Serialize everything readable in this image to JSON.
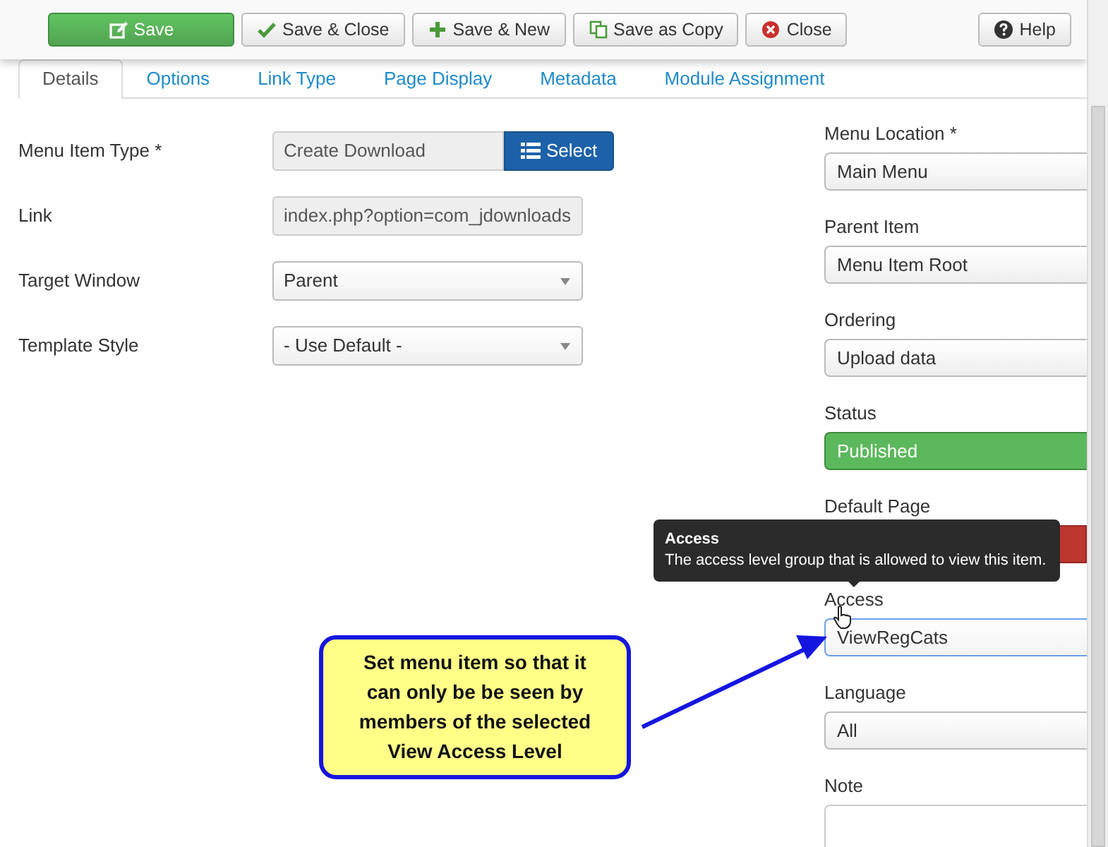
{
  "toolbar": {
    "buttons": [
      {
        "label": "Save",
        "kind": "save"
      },
      {
        "label": "Save & Close",
        "kind": "save-close"
      },
      {
        "label": "Save & New",
        "kind": "save-new"
      },
      {
        "label": "Save as Copy",
        "kind": "copy"
      },
      {
        "label": "Close",
        "kind": "close"
      }
    ],
    "help": {
      "label": "Help"
    }
  },
  "tabs": [
    {
      "label": "Details",
      "selected": true
    },
    {
      "label": "Options",
      "selected": false
    },
    {
      "label": "Link Type",
      "selected": false
    },
    {
      "label": "Page Display",
      "selected": false
    },
    {
      "label": "Metadata",
      "selected": false
    },
    {
      "label": "Module Assignment",
      "selected": false
    }
  ],
  "main_fields": [
    {
      "label": "Menu Item Type *",
      "kind": "type",
      "value": "Create Download",
      "button": "Select"
    },
    {
      "label": "Link",
      "kind": "readonly",
      "value": "index.php?option=com_jdownloads"
    },
    {
      "label": "Target Window",
      "kind": "select",
      "value": "Parent"
    },
    {
      "label": "Template Style",
      "kind": "select",
      "value": "- Use Default -"
    }
  ],
  "side_fields": [
    {
      "label": "Menu Location *",
      "kind": "select",
      "value": "Main Menu",
      "focused": false
    },
    {
      "label": "Parent Item",
      "kind": "select",
      "value": "Menu Item Root",
      "focused": false
    },
    {
      "label": "Ordering",
      "kind": "select",
      "value": "Upload data",
      "focused": false
    },
    {
      "label": "Status",
      "kind": "status",
      "value": "Published"
    },
    {
      "label": "Default Page",
      "kind": "toggle",
      "options": [
        {
          "selected": true
        }
      ]
    },
    {
      "label": "Access",
      "kind": "select",
      "value": "ViewRegCats",
      "focused": true
    },
    {
      "label": "Language",
      "kind": "select",
      "value": "All",
      "focused": false
    },
    {
      "label": "Note",
      "kind": "textarea"
    }
  ],
  "tooltip": {
    "title": "Access",
    "text": "The access level group that is allowed to view this item."
  },
  "callout": {
    "text": "Set menu item so that it can only be be seen by members of  the selected View Access Level"
  }
}
